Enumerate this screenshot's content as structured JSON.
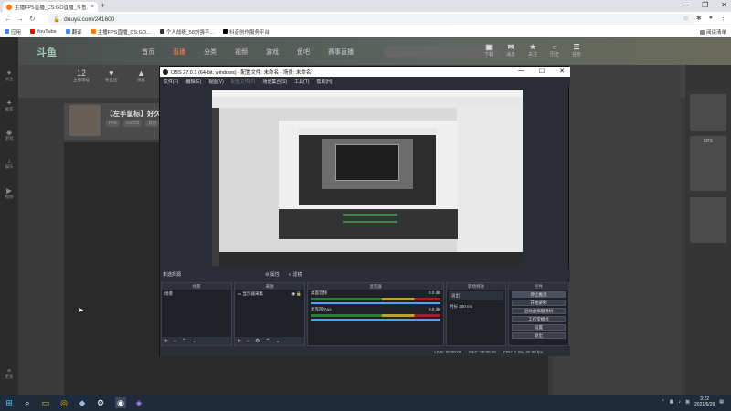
{
  "browser": {
    "tab_title": "主播FPS直播_CS:GO直播_斗鱼...",
    "url": "douyu.com/241600",
    "bookmarks": [
      "应用",
      "YouTube",
      "翻译",
      "主播FPS直播_CS:GO...",
      "个人战绩_58刘强平...",
      "抖音创作服务平台"
    ],
    "reading_list": "阅读清单"
  },
  "site": {
    "side_items": [
      "关注",
      "推荐",
      "游戏",
      "娱乐",
      "视频",
      "更多"
    ],
    "logo": "斗鱼",
    "nav": [
      "首页",
      "直播",
      "分类",
      "视频",
      "游戏",
      "鱼吧",
      "赛事直播"
    ],
    "nav_active_index": 1,
    "nav_right": [
      {
        "icon": "▣",
        "label": "下载"
      },
      {
        "icon": "✉",
        "label": "消息"
      },
      {
        "icon": "★",
        "label": "关注"
      },
      {
        "icon": "○",
        "label": "历史"
      },
      {
        "icon": "☰",
        "label": "任务"
      }
    ],
    "stats": [
      {
        "value": "12",
        "label": "主播等级"
      },
      {
        "value": "♥",
        "label": "粉丝团"
      },
      {
        "value": "▲",
        "label": "贡献"
      }
    ],
    "room_title": "【左手鼠标】好久",
    "room_tags": [
      "FPS",
      "CS:GO",
      "其他"
    ],
    "side_badge": "FPS"
  },
  "obs": {
    "title": "OBS 27.0.1 (64-bit, windows) - 配置文件: 未命名 - 场景: 未命名",
    "menu": [
      "文件(F)",
      "编辑(E)",
      "视图(V)",
      "配置文件(P)",
      "场景集合(S)",
      "工具(T)",
      "帮助(H)"
    ],
    "menu_dim_index": 3,
    "selected_source": "未选择源",
    "props_label": "属性",
    "filters_label": "滤镜",
    "scenes": {
      "header": "场景",
      "item": "场景"
    },
    "sources": {
      "header": "来源",
      "item": "显示器采集"
    },
    "mixer": {
      "header": "混音器",
      "channels": [
        {
          "name": "桌面音频",
          "db": "0.0 dB"
        },
        {
          "name": "麦克风/Aux",
          "db": "0.0 dB"
        },
        {
          "name": "麦克风",
          "db": "0.0 dB"
        }
      ]
    },
    "transitions": {
      "header": "转场特效",
      "type": "淡出",
      "duration_label": "时长",
      "duration": "300 ms"
    },
    "controls": {
      "header": "控件",
      "buttons": [
        "停止推流",
        "开始录制",
        "启动虚拟摄像机",
        "工作室模式",
        "设置",
        "退出"
      ]
    },
    "status": {
      "live": "LIVE: 00:00:00",
      "rec": "REC: 00:00:00",
      "cpu": "CPU: 1.2%, 60.00 fps"
    }
  },
  "taskbar": {
    "time": "3:22",
    "date": "2021/6/29",
    "lang": "英"
  },
  "colors": {
    "obs_bg": "#2b2e38",
    "accent": "#ff7e5a",
    "taskbar": "#1d2b3a"
  }
}
